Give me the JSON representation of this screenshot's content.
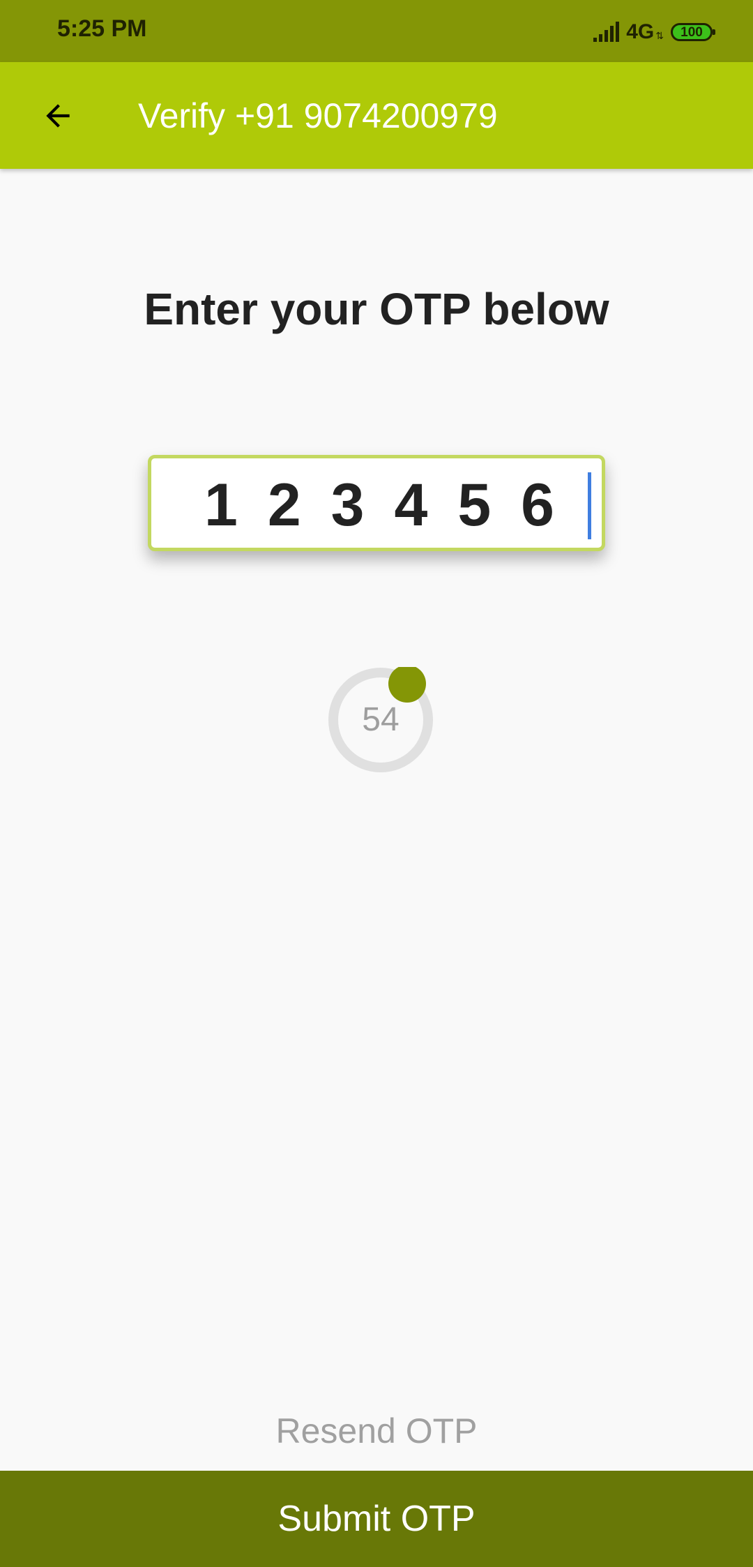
{
  "status_bar": {
    "time": "5:25 PM",
    "network": "4G",
    "network_activity_icon": "up-down-arrows-icon",
    "battery": "100",
    "icons": [
      "signal-bars-icon",
      "battery-icon"
    ]
  },
  "app_bar": {
    "back_icon": "arrow-left-icon",
    "title": "Verify +91 9074200979"
  },
  "main": {
    "heading": "Enter your OTP below",
    "otp_value": "123456",
    "countdown": "54"
  },
  "footer": {
    "resend_label": "Resend OTP",
    "submit_label": "Submit OTP"
  },
  "colors": {
    "status_bar": "#849606",
    "app_bar": "#afca08",
    "otp_border": "#c3d860",
    "text_cursor": "#3f7ee0",
    "countdown_track": "#e0e0e0",
    "countdown_indicator": "#849606",
    "submit_button": "#687807",
    "background": "#f9f9f9"
  }
}
